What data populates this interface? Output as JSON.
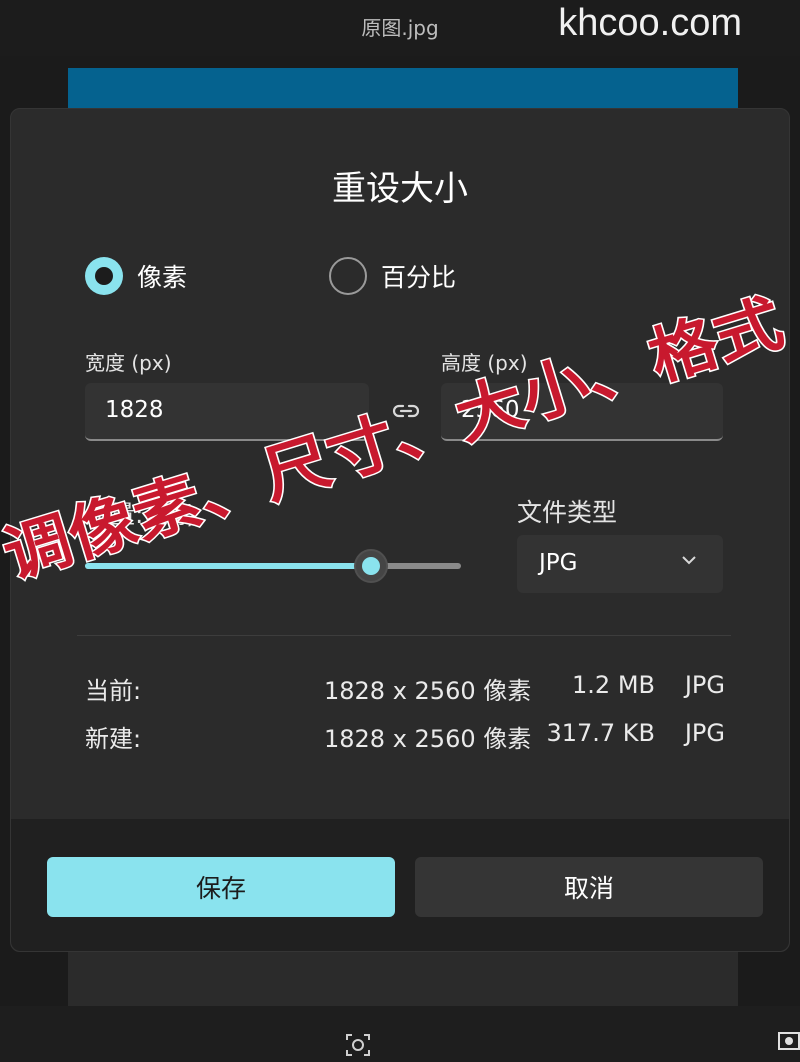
{
  "window": {
    "file_title": "原图.jpg",
    "watermark": "khcoo.com"
  },
  "dialog": {
    "title": "重设大小",
    "mode_options": [
      {
        "label": "像素",
        "selected": true
      },
      {
        "label": "百分比",
        "selected": false
      }
    ],
    "width_label": "宽度 (px)",
    "width_value": "1828",
    "height_label": "高度 (px)",
    "height_value": "2560",
    "quality_label": "质量:",
    "quality_value": "(高)",
    "quality_level": 0.76,
    "filetype_label": "文件类型",
    "filetype_value": "JPG",
    "current": {
      "label": "当前:",
      "dimensions": "1828 x 2560 像素",
      "size": "1.2 MB",
      "format": "JPG"
    },
    "new": {
      "label": "新建:",
      "dimensions": "1828 x 2560 像素",
      "size": "317.7 KB",
      "format": "JPG"
    },
    "save_label": "保存",
    "cancel_label": "取消"
  },
  "overlay_caption": "调像素、尺寸、大小、格式",
  "colors": {
    "accent": "#8ae3ee",
    "overlay_text": "#c8192e",
    "dialog_bg": "#2b2b2b",
    "strip": "#05628f"
  },
  "icons": [
    "link-icon",
    "chevron-down-icon",
    "camera-icon",
    "screen-icon"
  ]
}
